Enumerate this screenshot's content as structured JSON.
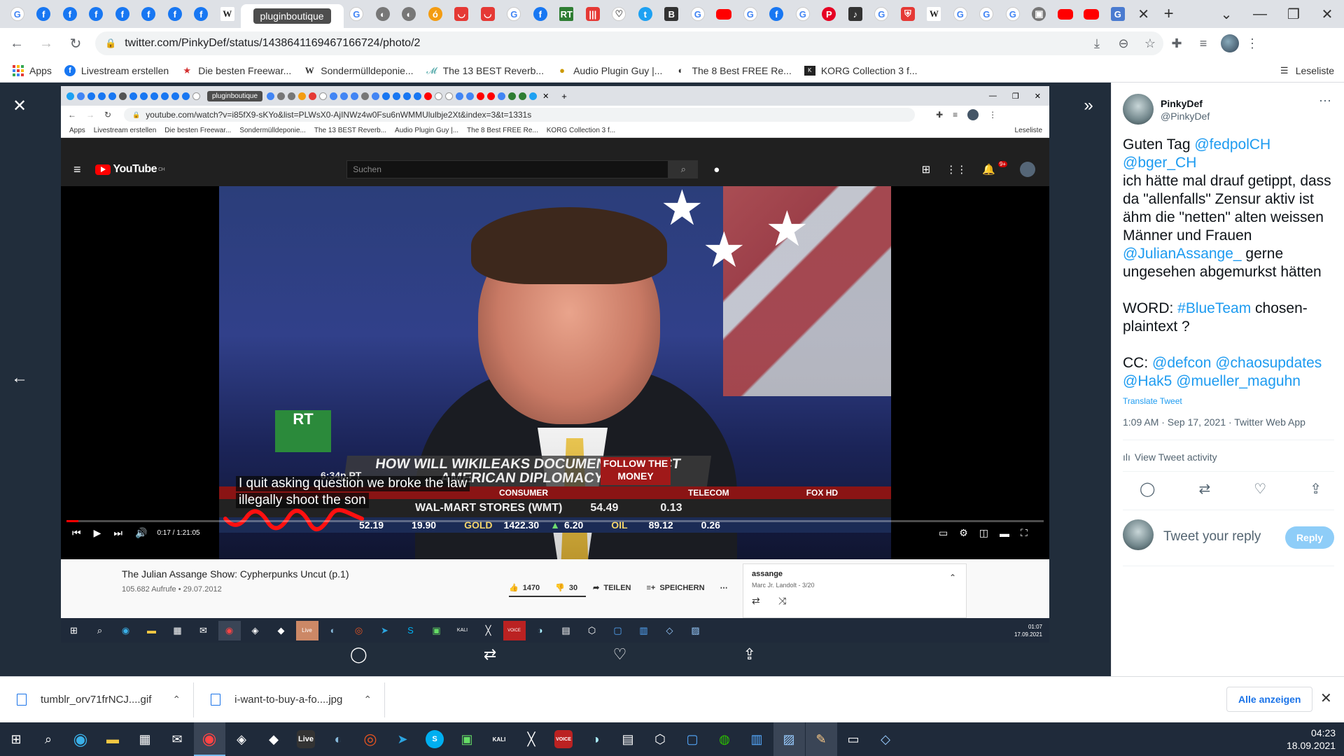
{
  "browser": {
    "active_tab_label": "pluginboutique",
    "url": "twitter.com/PinkyDef/status/1438641169467166724/photo/2",
    "bookmarks": [
      {
        "label": "Apps",
        "icon": "apps-grid-icon"
      },
      {
        "label": "Livestream erstellen",
        "icon": "facebook-icon"
      },
      {
        "label": "Die besten Freewar...",
        "icon": "star-icon"
      },
      {
        "label": "Sondermülldeponie...",
        "icon": "wikipedia-icon"
      },
      {
        "label": "The 13 BEST Reverb...",
        "icon": "bird-icon"
      },
      {
        "label": "Audio Plugin Guy |...",
        "icon": "duck-icon"
      },
      {
        "label": "The 8 Best FREE Re...",
        "icon": "moon-icon"
      },
      {
        "label": "KORG Collection 3 f...",
        "icon": "korg-icon"
      }
    ],
    "reading_list_label": "Leseliste"
  },
  "screenshot": {
    "active_tab_label": "pluginboutique",
    "url": "youtube.com/watch?v=i85fX9-sKYo&list=PLWsX0-AjINWz4w0Fsu6nWMMUlulbje2Xt&index=3&t=1331s",
    "bookmarks": [
      "Apps",
      "Livestream erstellen",
      "Die besten Freewar...",
      "Sondermülldeponie...",
      "The 13 BEST Reverb...",
      "Audio Plugin Guy |...",
      "The 8 Best FREE Re...",
      "KORG Collection 3 f..."
    ],
    "reading_list_label": "Leseliste",
    "yt_logo": "YouTube",
    "yt_country": "CH",
    "search_placeholder": "Suchen",
    "notification_count": "9+",
    "chyron": {
      "headline": "HOW WILL WIKILEAKS DOCUMENTS IMPACT AMERICAN DIPLOMACY?",
      "follow": "FOLLOW THE MONEY",
      "time": "6:34p PT",
      "cat1": "CONSUMER",
      "cat2": "TELECOM",
      "network": "FOX HD",
      "stock": "WAL-MART STORES (WMT)",
      "stock_price": "54.49",
      "stock_change": "0.13",
      "ticker": [
        {
          "label": "",
          "value": "52.19"
        },
        {
          "label": "",
          "value": "19.90"
        },
        {
          "label": "GOLD",
          "value": "1422.30"
        },
        {
          "label": "",
          "value": "6.20"
        },
        {
          "label": "OIL",
          "value": "89.12"
        },
        {
          "label": "",
          "value": "0.26"
        }
      ]
    },
    "subtitles": [
      "I quit asking question we broke the law",
      "illegally shoot the son"
    ],
    "time_display": "0:17 / 1:21:05",
    "progress_fraction": 0.0035,
    "video_title": "The Julian Assange Show: Cypherpunks Uncut (p.1)",
    "video_meta": "105.682 Aufrufe • 29.07.2012",
    "likes": "1470",
    "dislikes": "30",
    "share_label": "TEILEN",
    "save_label": "SPEICHERN",
    "playlist_title": "assange",
    "playlist_meta": "Marc Jr. Landolt - 3/20",
    "taskbar_time": "01:07",
    "taskbar_date": "17.09.2021"
  },
  "tweet": {
    "author_name": "PinkyDef",
    "author_handle": "@PinkyDef",
    "lines": {
      "l1_prefix": "Guten Tag ",
      "m1": "@fedpolCH",
      "m2": "@bger_CH",
      "l2": "ich hätte mal drauf getippt, dass da \"allenfalls\" Zensur aktiv ist ähm die \"netten\" alten weissen Männer und Frauen",
      "m3": "@JulianAssange_",
      "l3": " gerne ungesehen abgemurkst hätten",
      "l4_prefix": "WORD: ",
      "m4": "#BlueTeam",
      "l4_suffix": " chosen-plaintext ?",
      "l5_prefix": "CC: ",
      "m5": "@defcon",
      "m6": "@chaosupdates",
      "m7": "@Hak5",
      "m8": "@mueller_maguhn"
    },
    "translate_label": "Translate Tweet",
    "timestamp": "1:09 AM · Sep 17, 2021 · Twitter Web App",
    "activity_label": "View Tweet activity",
    "reply_placeholder": "Tweet your reply",
    "reply_button": "Reply"
  },
  "downloads": {
    "items": [
      "tumblr_orv71frNCJ....gif",
      "i-want-to-buy-a-fo....jpg"
    ],
    "show_all": "Alle anzeigen"
  },
  "taskbar": {
    "time": "04:23",
    "date": "18.09.2021"
  }
}
